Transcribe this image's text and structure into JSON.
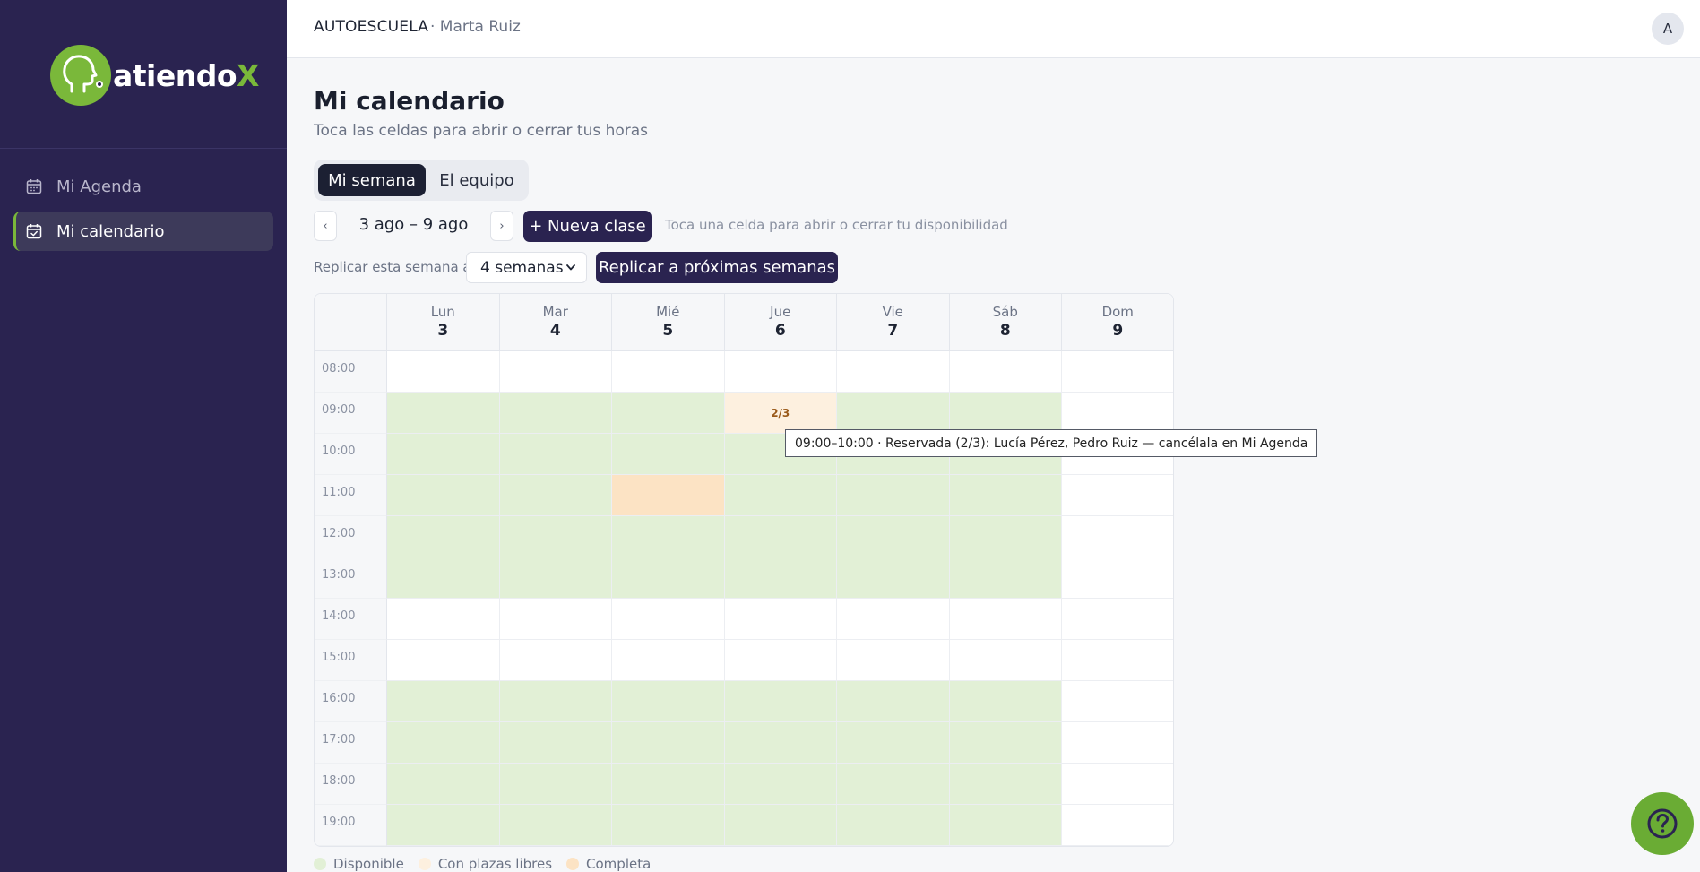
{
  "brand": {
    "name_main": "atiendo",
    "name_accent": "X",
    "accent_color": "#7ab83a",
    "sidebar_color": "#2a2350"
  },
  "sidebar": {
    "items": [
      {
        "label": "Mi Agenda",
        "icon": "calendar-icon",
        "active": false
      },
      {
        "label": "Mi calendario",
        "icon": "calendar-check-icon",
        "active": true
      }
    ]
  },
  "topbar": {
    "org": "AUTOESCUELA",
    "user": "· Marta Ruiz",
    "avatar_initial": "A"
  },
  "page": {
    "title": "Mi calendario",
    "subtitle": "Toca las celdas para abrir o cerrar tus horas"
  },
  "tabs": [
    {
      "label": "Mi semana",
      "active": true
    },
    {
      "label": "El equipo",
      "active": false
    }
  ],
  "toolbar": {
    "prev": "‹",
    "next": "›",
    "week_range": "3 ago – 9 ago",
    "new_class": "+ Nueva clase",
    "hint": "Toca una celda para abrir o cerrar tu disponibilidad"
  },
  "replicate": {
    "label": "Replicar esta semana a",
    "selected": "4 semanas",
    "button": "Replicar a próximas semanas"
  },
  "calendar": {
    "days": [
      {
        "name": "Lun",
        "num": "3"
      },
      {
        "name": "Mar",
        "num": "4"
      },
      {
        "name": "Mié",
        "num": "5"
      },
      {
        "name": "Jue",
        "num": "6"
      },
      {
        "name": "Vie",
        "num": "7"
      },
      {
        "name": "Sáb",
        "num": "8"
      },
      {
        "name": "Dom",
        "num": "9"
      }
    ],
    "times": [
      "08:00",
      "09:00",
      "10:00",
      "11:00",
      "12:00",
      "13:00",
      "14:00",
      "15:00",
      "16:00",
      "17:00",
      "18:00",
      "19:00"
    ],
    "rows": [
      [
        "",
        "",
        "",
        "",
        "",
        "",
        ""
      ],
      [
        "available",
        "available",
        "available",
        "partial",
        "available",
        "available",
        ""
      ],
      [
        "available",
        "available",
        "available",
        "available",
        "available",
        "available",
        ""
      ],
      [
        "available",
        "available",
        "full",
        "available",
        "available",
        "available",
        ""
      ],
      [
        "available",
        "available",
        "available",
        "available",
        "available",
        "available",
        ""
      ],
      [
        "available",
        "available",
        "available",
        "available",
        "available",
        "available",
        ""
      ],
      [
        "",
        "",
        "",
        "",
        "",
        "",
        ""
      ],
      [
        "",
        "",
        "",
        "",
        "",
        "",
        ""
      ],
      [
        "available",
        "available",
        "available",
        "available",
        "available",
        "available",
        ""
      ],
      [
        "available",
        "available",
        "available",
        "available",
        "available",
        "available",
        ""
      ],
      [
        "available",
        "available",
        "available",
        "available",
        "available",
        "available",
        ""
      ],
      [
        "available",
        "available",
        "available",
        "available",
        "available",
        "available",
        ""
      ]
    ],
    "cell_labels": {
      "1-3": "2/3"
    },
    "colors": {
      "available": "#e2f0d6",
      "partial": "#fdf0df",
      "full": "#fce3c4"
    }
  },
  "tooltip": "09:00–10:00 · Reservada (2/3): Lucía Pérez, Pedro Ruiz — cancélala en Mi Agenda",
  "legend": [
    {
      "label": "Disponible",
      "color": "#e2f0d6"
    },
    {
      "label": "Con plazas libres",
      "color": "#fdf0df"
    },
    {
      "label": "Completa",
      "color": "#fce3c4"
    }
  ],
  "help": {
    "icon": "help-icon"
  }
}
